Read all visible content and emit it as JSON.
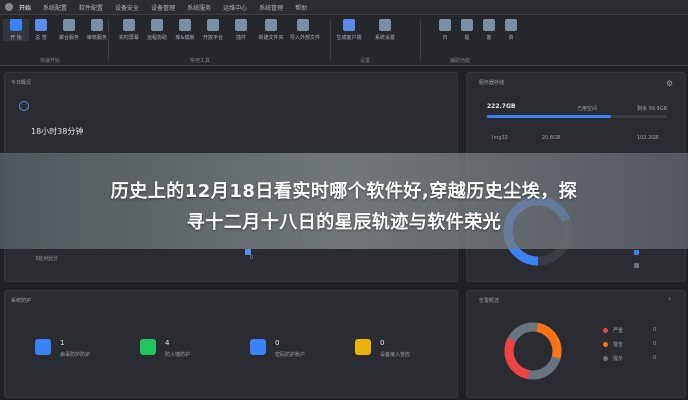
{
  "menu": {
    "tabs": [
      {
        "label": "开始"
      },
      {
        "label": "系统配置"
      },
      {
        "label": "软件配置"
      },
      {
        "label": "设备安全"
      },
      {
        "label": "设备管理"
      },
      {
        "label": "系统服务"
      },
      {
        "label": "运维中心"
      },
      {
        "label": "系统管理"
      },
      {
        "label": "帮助"
      }
    ]
  },
  "ribbon": {
    "items": [
      {
        "label": "开 始",
        "icon": "home-icon",
        "color": "#3b82f6"
      },
      {
        "label": "总 览",
        "icon": "overview-icon",
        "color": "#5b8def"
      },
      {
        "label": "聚合服务",
        "icon": "grid-icon",
        "color": "#7a8fa8"
      },
      {
        "label": "审核服务",
        "icon": "shield-icon",
        "color": "#7a8fa8"
      },
      {
        "label": "实时屏幕",
        "icon": "monitor-icon",
        "color": "#7a8fa8"
      },
      {
        "label": "远程协助",
        "icon": "remote-icon",
        "color": "#7a8fa8"
      },
      {
        "label": "库&模板",
        "icon": "library-icon",
        "color": "#7a8fa8"
      },
      {
        "label": "开放平台",
        "icon": "platform-icon",
        "color": "#7a8fa8"
      },
      {
        "label": "插件",
        "icon": "plugin-icon",
        "color": "#7a8fa8"
      },
      {
        "label": "新建文件夹",
        "icon": "folder-icon",
        "color": "#7a8fa8"
      },
      {
        "label": "导入外部文件",
        "icon": "import-icon",
        "color": "#7a8fa8"
      },
      {
        "label": "生成客户端",
        "icon": "download-icon",
        "color": "#5b8def"
      },
      {
        "label": "系统设置",
        "icon": "gear-icon",
        "color": "#7a8fa8"
      },
      {
        "label": "日",
        "icon": "calendar-icon",
        "color": "#7a8fa8"
      },
      {
        "label": "提",
        "icon": "notice-icon",
        "color": "#7a8fa8"
      },
      {
        "label": "客",
        "icon": "client-icon",
        "color": "#7a8fa8"
      },
      {
        "label": "资",
        "icon": "asset-icon",
        "color": "#7a8fa8"
      }
    ],
    "groups": [
      {
        "label": "快速开始"
      },
      {
        "label": "常用工具"
      },
      {
        "label": "设置"
      },
      {
        "label": "辅助功能"
      }
    ]
  },
  "today": {
    "title": "今日概况",
    "duration": "18小时38分钟",
    "footer_left": "3处对比分",
    "footer_mid": "0"
  },
  "storage": {
    "title": "服务器存储",
    "used": "222.7GB",
    "used_label": "已用空间",
    "free_label": "剩余 99.9GB",
    "row_left": "Img32",
    "row_mid": "20.6GB",
    "row_right": "102.2GB",
    "usage_fraction": 0.69,
    "ring_color": "#3b82f6"
  },
  "system": {
    "title": "系统防护",
    "items": [
      {
        "count": "1",
        "label": "病毒防护防护",
        "icon": "shield-icon",
        "color": "#3b82f6"
      },
      {
        "count": "4",
        "label": "防火墙防护",
        "icon": "firewall-icon",
        "color": "#22c55e"
      },
      {
        "count": "0",
        "label": "密码防护账户",
        "icon": "account-icon",
        "color": "#3b82f6"
      },
      {
        "count": "0",
        "label": "设备接入管控",
        "icon": "device-icon",
        "color": "#eab308"
      }
    ]
  },
  "alerts": {
    "title": "告警概述",
    "legend": [
      {
        "label": "严重",
        "value": "0",
        "color": "#ef4444"
      },
      {
        "label": "警告",
        "value": "0",
        "color": "#f97316"
      },
      {
        "label": "提示",
        "value": "0",
        "color": "#6b7280"
      }
    ]
  },
  "banner": {
    "line1": "历史上的12月18日看实时哪个软件好,穿越历史尘埃，探",
    "line2": "寻十二月十八日的星辰轨迹与软件荣光"
  }
}
